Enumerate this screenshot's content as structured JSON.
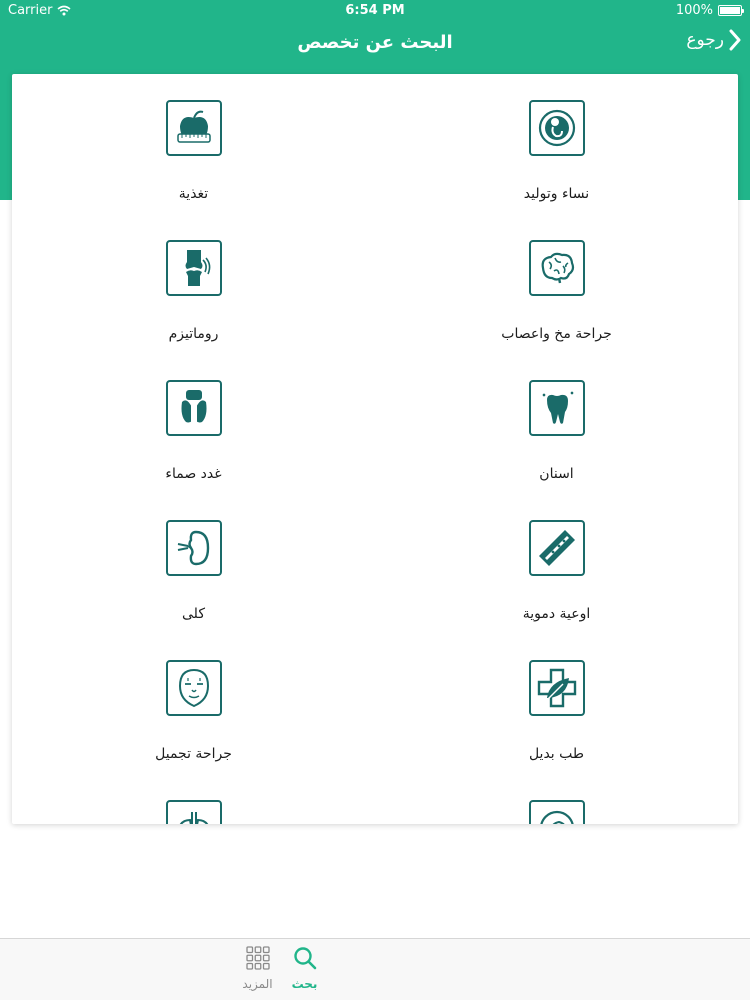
{
  "status_bar": {
    "carrier": "Carrier",
    "time": "6:54 PM",
    "battery": "100%"
  },
  "nav": {
    "title": "البحث عن تخصص",
    "back_label": "رجوع"
  },
  "colors": {
    "brand": "#21b58a",
    "icon_stroke": "#1a6b69"
  },
  "specialties": [
    {
      "label": "نساء وتوليد",
      "icon": "fetus-icon"
    },
    {
      "label": "تغذية",
      "icon": "apple-tape-icon"
    },
    {
      "label": "جراحة مخ واعصاب",
      "icon": "brain-icon"
    },
    {
      "label": "روماتيزم",
      "icon": "knee-joint-icon"
    },
    {
      "label": "اسنان",
      "icon": "tooth-icon"
    },
    {
      "label": "غدد صماء",
      "icon": "thyroid-icon"
    },
    {
      "label": "اوعية دموية",
      "icon": "blood-vessel-icon"
    },
    {
      "label": "كلى",
      "icon": "kidney-icon"
    },
    {
      "label": "طب بديل",
      "icon": "herbal-cross-icon"
    },
    {
      "label": "جراحة تجميل",
      "icon": "face-icon"
    },
    {
      "label": "",
      "icon": "head-profile-icon"
    },
    {
      "label": "",
      "icon": "lungs-icon"
    }
  ],
  "tabs": [
    {
      "label": "بحث",
      "icon": "search-icon",
      "active": true
    },
    {
      "label": "المزيد",
      "icon": "grid-menu-icon",
      "active": false
    }
  ]
}
